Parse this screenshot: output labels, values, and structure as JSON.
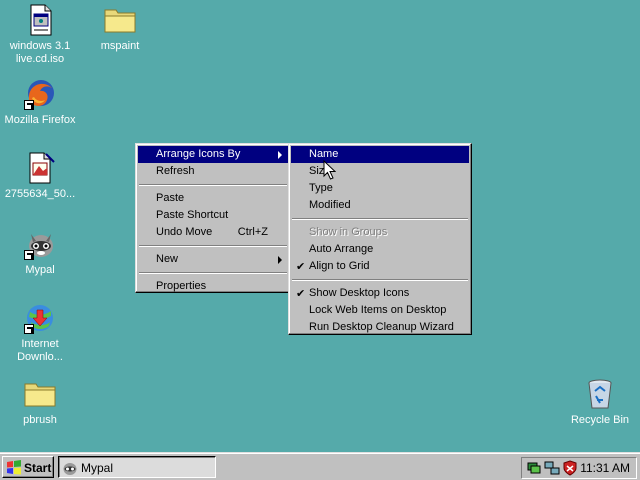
{
  "desktop": {
    "icons": [
      {
        "label": "windows 3.1 live.cd.iso",
        "icon": "iso-file-icon"
      },
      {
        "label": "mspaint",
        "icon": "folder-icon"
      },
      {
        "label": "Mozilla Firefox",
        "icon": "firefox-icon"
      },
      {
        "label": "2755634_50...",
        "icon": "image-file-icon"
      },
      {
        "label": "Mypal",
        "icon": "mypal-icon"
      },
      {
        "label": "Internet Downlo...",
        "icon": "internet-download-manager-icon"
      },
      {
        "label": "pbrush",
        "icon": "folder-icon"
      },
      {
        "label": "Recycle Bin",
        "icon": "recycle-bin-icon"
      }
    ],
    "background_color": "#55aaaa"
  },
  "context_menu": {
    "items": [
      {
        "label": "Arrange Icons By",
        "submenu": true,
        "highlighted": true
      },
      {
        "label": "Refresh"
      },
      {
        "label": "Paste"
      },
      {
        "label": "Paste Shortcut"
      },
      {
        "label": "Undo Move",
        "shortcut": "Ctrl+Z"
      },
      {
        "label": "New",
        "submenu": true
      },
      {
        "label": "Properties"
      }
    ]
  },
  "submenu": {
    "items": [
      {
        "label": "Name",
        "highlighted": true
      },
      {
        "label": "Size"
      },
      {
        "label": "Type"
      },
      {
        "label": "Modified"
      },
      {
        "label": "Show in Groups",
        "disabled": true
      },
      {
        "label": "Auto Arrange"
      },
      {
        "label": "Align to Grid",
        "checked": true
      },
      {
        "label": "Show Desktop Icons",
        "checked": true
      },
      {
        "label": "Lock Web Items on Desktop"
      },
      {
        "label": "Run Desktop Cleanup Wizard"
      }
    ]
  },
  "taskbar": {
    "start_label": "Start",
    "task_label": "Mypal",
    "clock": "11:31 AM",
    "highlight_color": "#000080"
  }
}
